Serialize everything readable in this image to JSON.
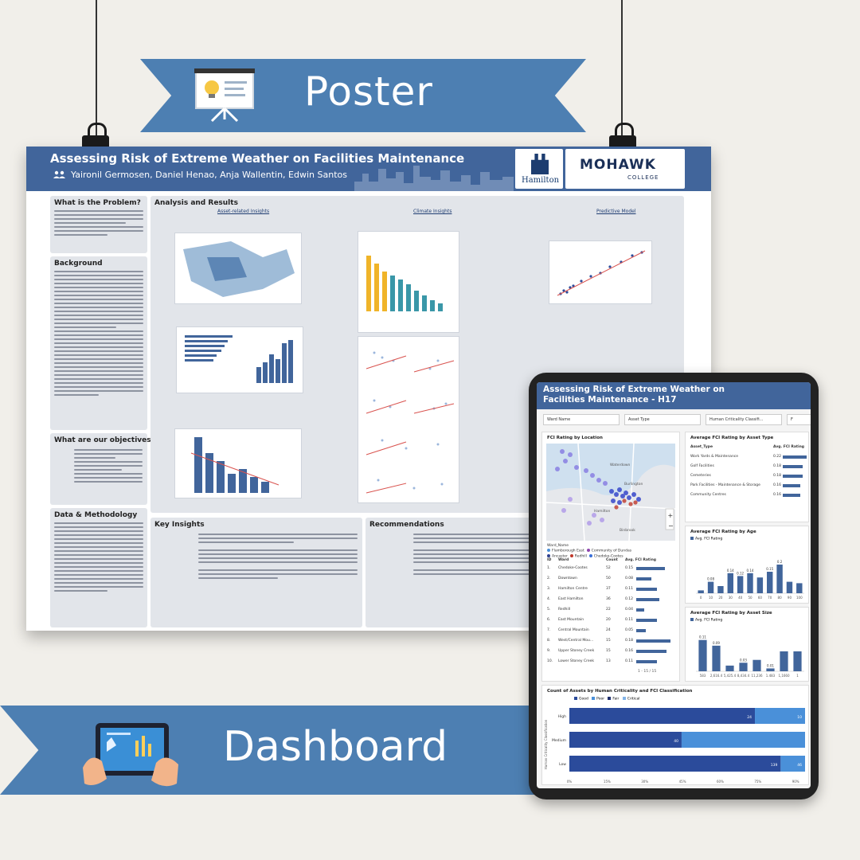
{
  "banner_poster": {
    "label": "Poster"
  },
  "banner_dashboard": {
    "label": "Dashboard"
  },
  "poster": {
    "title": "Assessing Risk of Extreme Weather on Facilities Maintenance",
    "authors": "Yaironil Germosen,  Daniel Henao, Anja Wallentin, Edwin Santos",
    "logo_city": "Hamilton",
    "logo_college": "MOHAWK",
    "logo_college_sub": "COLLEGE",
    "sections": {
      "problem": "What is the Problem?",
      "background": "Background",
      "objectives": "What are our objectives?",
      "data": "Data & Methodology",
      "analysis": "Analysis and Results",
      "asset_insights": "Asset-related Insights",
      "climate_insights": "Climate Insights",
      "predictive": "Predictive Model",
      "key_insights": "Key Insights",
      "recommendations": "Recommendations"
    }
  },
  "dashboard": {
    "title": "Assessing Risk of Extreme Weather on Facilities Maintenance - H17",
    "filters": [
      "Ward Name",
      "Asset Type",
      "Human Criticality Classifi...",
      "F"
    ],
    "fci_location": {
      "title": "FCI Rating by Location",
      "legend_heading": "Ward_Name",
      "legend_items": [
        "Flamborough East",
        "Community of Dundas",
        "Ancaster",
        "Redhill",
        "Chedoke-Cootes"
      ],
      "legend_colors": [
        "#4a90d9",
        "#8e44ad",
        "#2c3e8f",
        "#c0392b",
        "#3a6fd8"
      ],
      "map_labels": [
        "Burlington",
        "Hamilton",
        "Waterdown",
        "Binbrook"
      ],
      "columns": [
        "ID",
        "Ward",
        "Count",
        "Avg. FCI Rating"
      ],
      "rows": [
        {
          "id": "1.",
          "ward": "Chedoke-Cootes",
          "count": "52",
          "fci": "0.15",
          "fci_value": 0.15
        },
        {
          "id": "2.",
          "ward": "Downtown",
          "count": "50",
          "fci": "0.08",
          "fci_value": 0.08
        },
        {
          "id": "3.",
          "ward": "Hamilton Centre",
          "count": "37",
          "fci": "0.11",
          "fci_value": 0.11
        },
        {
          "id": "4.",
          "ward": "East Hamilton",
          "count": "36",
          "fci": "0.12",
          "fci_value": 0.12
        },
        {
          "id": "5.",
          "ward": "Redhill",
          "count": "22",
          "fci": "0.04",
          "fci_value": 0.04
        },
        {
          "id": "6.",
          "ward": "East Mountain",
          "count": "20",
          "fci": "0.11",
          "fci_value": 0.11
        },
        {
          "id": "7.",
          "ward": "Central Mountain",
          "count": "24",
          "fci": "0.05",
          "fci_value": 0.05
        },
        {
          "id": "8.",
          "ward": "West/Central Mou...",
          "count": "15",
          "fci": "0.18",
          "fci_value": 0.18
        },
        {
          "id": "9.",
          "ward": "Upper Stoney Creek",
          "count": "15",
          "fci": "0.16",
          "fci_value": 0.16
        },
        {
          "id": "10.",
          "ward": "Lower Stoney Creek",
          "count": "13",
          "fci": "0.11",
          "fci_value": 0.11
        }
      ],
      "pager": "1 - 15 / 15"
    },
    "asset_type": {
      "title": "Average FCI Rating by Asset Type",
      "columns": [
        "Asset_Type",
        "Avg. FCI Rating"
      ],
      "rows": [
        {
          "name": "Work Yards & Maintenance",
          "value": "0.22",
          "v": 0.22
        },
        {
          "name": "Golf Facilities",
          "value": "0.18",
          "v": 0.18
        },
        {
          "name": "Cemeteries",
          "value": "0.18",
          "v": 0.18
        },
        {
          "name": "Park Facilities - Maintenance & Storage",
          "value": "0.16",
          "v": 0.16
        },
        {
          "name": "Community Centres",
          "value": "0.16",
          "v": 0.16
        }
      ]
    },
    "chart_data": [
      {
        "type": "bar",
        "title": "Average FCI Rating by Age",
        "legend": "Avg. FCI Rating",
        "categories": [
          "0",
          "10",
          "20",
          "30",
          "40",
          "50",
          "60",
          "70",
          "80",
          "90",
          "100"
        ],
        "values": [
          0.02,
          0.08,
          0.05,
          0.14,
          0.12,
          0.14,
          0.11,
          0.15,
          0.2,
          0.08,
          0.07
        ],
        "data_labels": [
          "",
          "0.08",
          "",
          "0.14",
          "0.12",
          "0.14",
          "",
          "0.15",
          "0.2",
          "",
          ""
        ]
      },
      {
        "type": "bar",
        "title": "Average FCI Rating by Asset Size",
        "legend": "Avg. FCI Rating",
        "categories": [
          "583",
          "2,616.4",
          "5,425.4",
          "8,434.4",
          "11,236",
          "1.483",
          "1,1660",
          "1"
        ],
        "values": [
          0.11,
          0.09,
          0.02,
          0.03,
          0.04,
          0.01,
          0.07,
          0.07
        ],
        "data_labels": [
          "0.11",
          "0.09",
          "",
          "0.03",
          "",
          "0.01",
          "",
          ""
        ]
      },
      {
        "type": "bar",
        "title": "Count of Assets by Human Criticality and FCI Classification",
        "ylabel": "Human Criticality Classification",
        "categories": [
          "High",
          "Medium",
          "Low"
        ],
        "series": [
          {
            "name": "Good",
            "values": [
              74,
              40,
              130
            ]
          },
          {
            "name": "Poor",
            "values": [
              20,
              44,
              15
            ]
          },
          {
            "name": "Fair",
            "values": [
              0,
              0,
              0
            ]
          },
          {
            "name": "Critical",
            "values": [
              0,
              0,
              0
            ]
          }
        ],
        "bar_labels": [
          "24",
          "10",
          "40",
          "139",
          "46"
        ],
        "x_ticks": [
          "0%",
          "15%",
          "30%",
          "45%",
          "60%",
          "75%",
          "90%"
        ],
        "colors": [
          "#2b4b9b",
          "#4a90d9",
          "#1f2f6e",
          "#82b4e8"
        ]
      }
    ]
  }
}
